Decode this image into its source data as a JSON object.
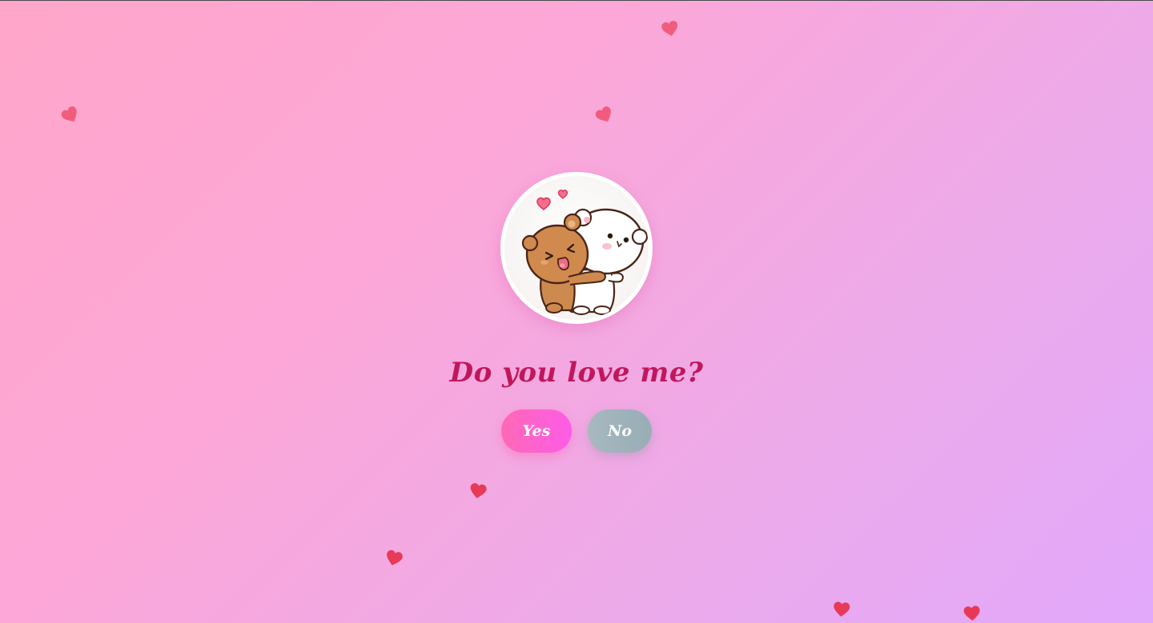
{
  "page": {
    "question": "Do you love me?"
  },
  "buttons": {
    "yes_label": "Yes",
    "no_label": "No"
  },
  "avatar": {
    "description_icon": "bears-hugging-illustration"
  },
  "decor": {
    "icon": "heart-icon",
    "colors": [
      "#f0506e",
      "#e8344f"
    ]
  },
  "colors": {
    "background_start": "#ffa6c9",
    "background_end": "#e2a8fb",
    "question_text": "#c0175c",
    "yes_button": "#ff69b4",
    "no_button": "#a7b8c0"
  }
}
